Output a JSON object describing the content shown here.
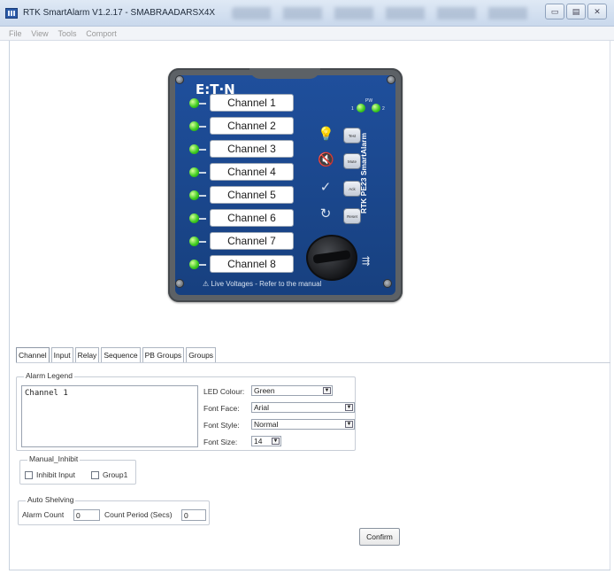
{
  "window": {
    "title": "RTK SmartAlarm V1.2.17 - SMABRAADARSX4X",
    "controls": [
      "▭",
      "▤",
      "✕"
    ]
  },
  "menu": {
    "items": [
      "File",
      "View",
      "Tools",
      "Comport"
    ]
  },
  "device": {
    "brand": "E:T·N",
    "side_text": "RTK PE23 SmartAlarm",
    "pw_label": "PW",
    "pw_labels": [
      "1",
      "2"
    ],
    "channels": [
      "Channel 1",
      "Channel 2",
      "Channel 3",
      "Channel 4",
      "Channel 5",
      "Channel 6",
      "Channel 7",
      "Channel 8"
    ],
    "buttons": [
      "Test",
      "Mute",
      "Ack",
      "Reset"
    ],
    "warning": "⚠ Live Voltages - Refer to the manual",
    "led_color": "#3fcc22"
  },
  "tabs": [
    "Channel",
    "Input",
    "Relay",
    "Sequence",
    "PB Groups",
    "Groups"
  ],
  "alarm_legend": {
    "title": "Alarm Legend",
    "text": "Channel 1",
    "led_colour_label": "LED Colour:",
    "led_colour_value": "Green",
    "font_face_label": "Font Face:",
    "font_face_value": "Arial",
    "font_style_label": "Font Style:",
    "font_style_value": "Normal",
    "font_size_label": "Font Size:",
    "font_size_value": "14"
  },
  "manual_inhibit": {
    "title": "Manual_Inhibit",
    "inhibit_input_label": "Inhibit Input",
    "group1_label": "Group1"
  },
  "auto_shelving": {
    "title": "Auto Shelving",
    "alarm_count_label": "Alarm Count",
    "alarm_count_value": "0",
    "count_period_label": "Count Period (Secs)",
    "count_period_value": "0"
  },
  "confirm_label": "Confirm"
}
